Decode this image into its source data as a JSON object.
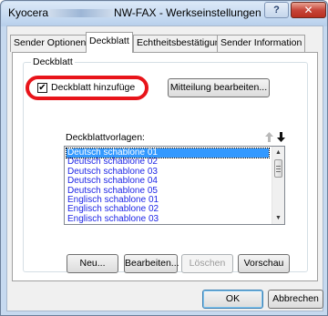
{
  "window": {
    "title_prefix": "Kyocera",
    "title_suffix": "NW-FAX - Werkseinstellungen",
    "help_label": "?",
    "close_label": "✕"
  },
  "tabs": [
    {
      "label": "Sender Optionen",
      "active": false
    },
    {
      "label": "Deckblatt",
      "active": true
    },
    {
      "label": "Echtheitsbestätigung",
      "active": false
    },
    {
      "label": "Sender Information",
      "active": false
    }
  ],
  "group": {
    "title": "Deckblatt",
    "checkbox": {
      "label": "Deckblatt hinzufüge",
      "checked": true,
      "mark": "✔"
    },
    "edit_message_label": "Mitteilung bearbeiten...",
    "templates_label": "Deckblattvorlagen:",
    "sort_up_icon": "arrow-up",
    "sort_down_icon": "arrow-down",
    "templates": [
      "Deutsch schablone 01",
      "Deutsch schablone 02",
      "Deutsch schablone 03",
      "Deutsch schablone 04",
      "Deutsch schablone 05",
      "Englisch schablone 01",
      "Englisch schablone 02",
      "Englisch schablone 03"
    ],
    "selected_index": 0,
    "buttons": {
      "new": "Neu...",
      "edit": "Bearbeiten...",
      "delete": "Löschen",
      "preview": "Vorschau"
    }
  },
  "footer": {
    "ok": "OK",
    "cancel": "Abbrechen"
  },
  "colors": {
    "highlight": "#e8141a",
    "list_text": "#1f27e6",
    "selection": "#3399ff"
  }
}
